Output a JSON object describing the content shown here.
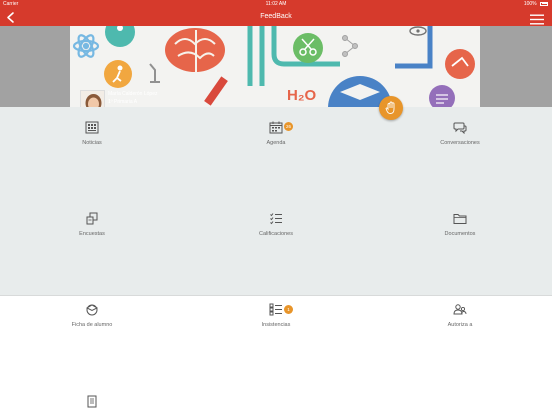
{
  "status_bar": {
    "carrier": "Carrier",
    "time": "11:02 AM",
    "battery": "100%"
  },
  "nav": {
    "title": "FeedBack",
    "back_icon": "chevron-left-icon",
    "menu_icon": "hamburger-menu-icon"
  },
  "profile": {
    "name": "María Calderón López",
    "class": "1º Primaria A"
  },
  "fab": {
    "icon": "hand-icon"
  },
  "grid": [
    {
      "label": "Noticias",
      "icon": "news-icon"
    },
    {
      "label": "Agenda",
      "icon": "calendar-icon",
      "badge": "26"
    },
    {
      "label": "Conversaciones",
      "icon": "chat-bubbles-icon"
    },
    {
      "label": "Encuestas",
      "icon": "survey-icon"
    },
    {
      "label": "Calificaciones",
      "icon": "grades-list-icon"
    },
    {
      "label": "Documentos",
      "icon": "folder-icon"
    }
  ],
  "lower": [
    {
      "label": "Ficha de alumno",
      "icon": "student-card-icon"
    },
    {
      "label": "Insistencias",
      "icon": "checklist-icon",
      "badge": "1"
    },
    {
      "label": "Autoriza a",
      "icon": "people-icon"
    },
    {
      "label": "",
      "icon": "document-icon"
    }
  ],
  "colors": {
    "brand": "#d63a2c",
    "accent": "#e8952a",
    "grid_bg": "#e8ecec"
  }
}
